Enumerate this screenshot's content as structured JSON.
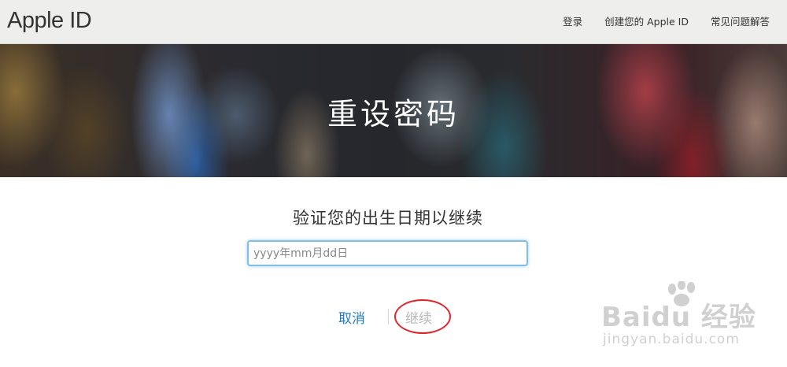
{
  "header": {
    "brand": "Apple ID",
    "nav": [
      {
        "label": "登录"
      },
      {
        "label": "创建您的 Apple ID"
      },
      {
        "label": "常见问题解答"
      }
    ]
  },
  "hero": {
    "title": "重设密码"
  },
  "form": {
    "prompt": "验证您的出生日期以继续",
    "date_input": {
      "value": "",
      "placeholder": "yyyy年mm月dd日"
    }
  },
  "actions": {
    "cancel_label": "取消",
    "continue_label": "继续"
  },
  "watermark": {
    "main": "Baidu 经验",
    "sub": "jingyan.baidu.com"
  },
  "colors": {
    "link": "#1d7cc4",
    "disabled": "#b8b8b8",
    "annotation": "#e0242a",
    "focus_ring": "#7fbfea"
  }
}
